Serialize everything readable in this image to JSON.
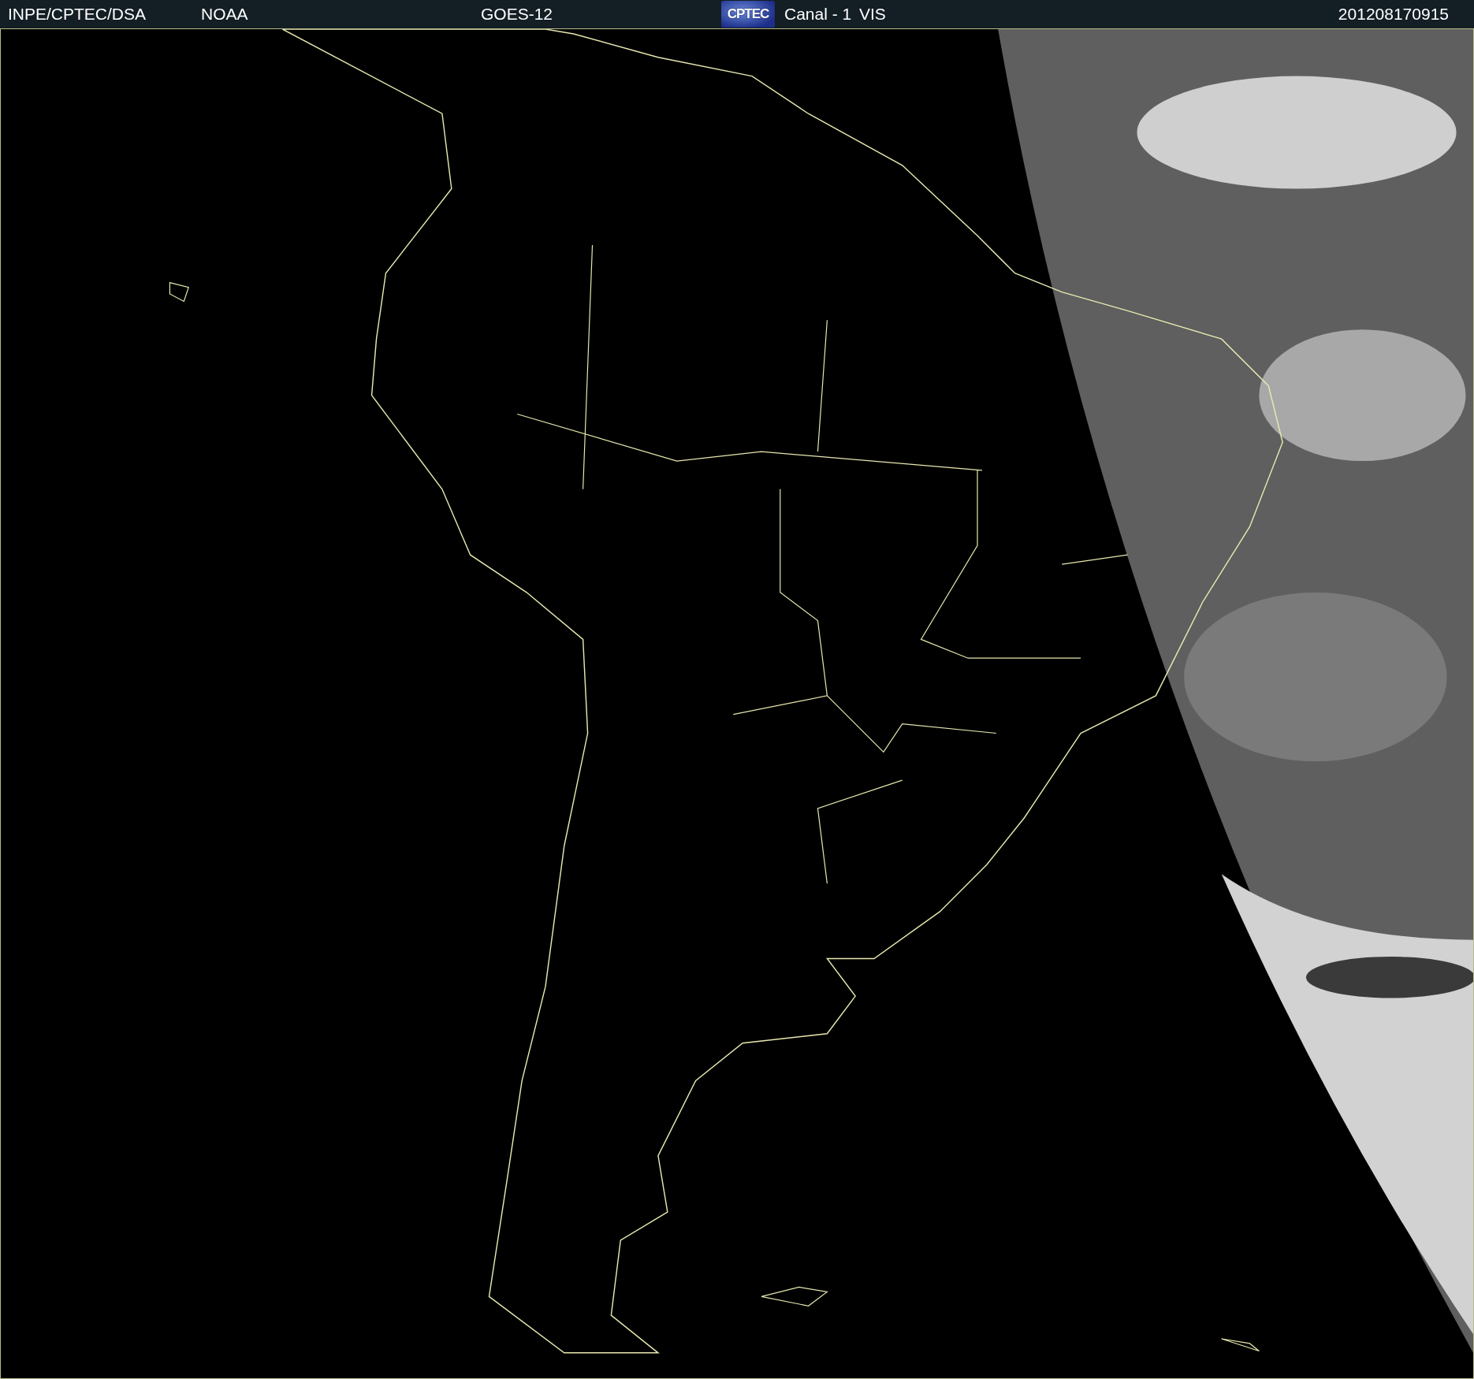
{
  "header": {
    "items": [
      {
        "kind": "text",
        "text": "INPE/CPTEC/DSA"
      },
      {
        "kind": "text",
        "text": "NOAA"
      },
      {
        "kind": "text",
        "text": "GOES-12"
      },
      {
        "kind": "logo",
        "text": "CPTEC"
      },
      {
        "kind": "text",
        "text": "Canal - 1"
      },
      {
        "kind": "text",
        "text": "VIS"
      },
      {
        "kind": "text",
        "text": "201208170915"
      }
    ]
  }
}
